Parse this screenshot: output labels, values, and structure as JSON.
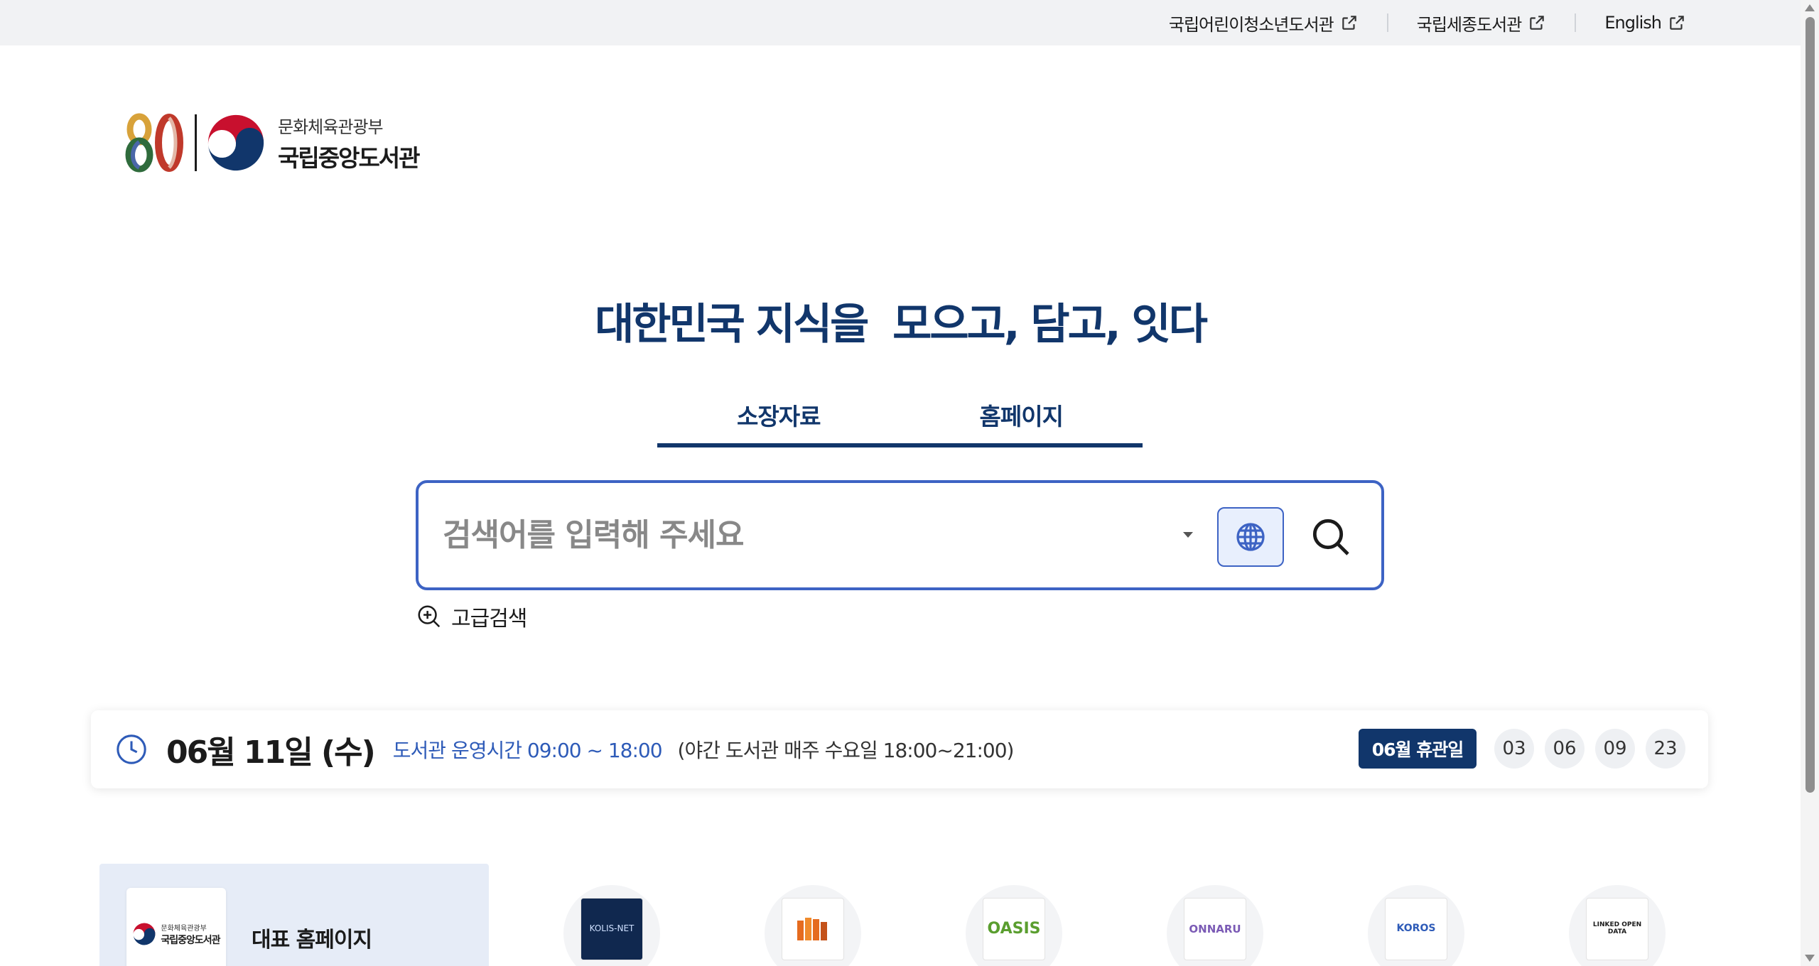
{
  "topbar": {
    "links": [
      {
        "label": "국립어린이청소년도서관"
      },
      {
        "label": "국립세종도서관"
      },
      {
        "label": "English"
      }
    ]
  },
  "logo": {
    "mark_text": "80",
    "ministry": "문화체육관광부",
    "library": "국립중앙도서관"
  },
  "headline": "대한민국 지식을  모으고, 담고, 잇다",
  "tabs": [
    {
      "label": "소장자료",
      "active": true
    },
    {
      "label": "홈페이지",
      "active": false
    }
  ],
  "search": {
    "placeholder": "검색어를 입력해 주세요",
    "value": ""
  },
  "advanced_search": "고급검색",
  "hours": {
    "date": "06월 11일 (수)",
    "open": "도서관 운영시간 09:00 ~ 18:00",
    "night": "(야간 도서관 매주 수요일 18:00~21:00)",
    "holiday_label": "06월 휴관일",
    "holiday_days": [
      "03",
      "06",
      "09",
      "23"
    ]
  },
  "representative": {
    "label": "대표 홈페이지",
    "logo_ministry": "문화체육관광부",
    "logo_library": "국립중앙도서관"
  },
  "sites": [
    {
      "text": "KOLIS-NET",
      "icon": "kolis-net-icon"
    },
    {
      "text": "",
      "icon": "books-icon"
    },
    {
      "text": "OASIS",
      "icon": "oasis-icon"
    },
    {
      "text": "ONNARU",
      "icon": "onnaru-icon"
    },
    {
      "text": "KOROS",
      "icon": "koros-icon"
    },
    {
      "text": "LINKED OPEN DATA",
      "icon": "linked-open-data-icon"
    }
  ],
  "colors": {
    "brand_navy": "#11366b",
    "accent_blue": "#3d63c4",
    "link_blue": "#2e5bb8"
  }
}
